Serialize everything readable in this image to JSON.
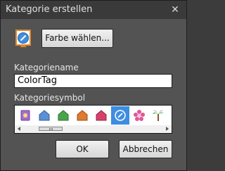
{
  "dialog": {
    "title": "Kategorie erstellen",
    "close_glyph": "✕"
  },
  "preview": {
    "icon": "tag-color-icon",
    "color": "#3f8fe0"
  },
  "color_button": {
    "label": "Farbe wählen..."
  },
  "name_field": {
    "label": "Kategoriename",
    "value": "ColorTag"
  },
  "symbols": {
    "label": "Kategoriesymbol",
    "items": [
      {
        "name": "flower-tag-icon",
        "color": "#a66bd3"
      },
      {
        "name": "house-blue-icon",
        "color": "#5c8fd6"
      },
      {
        "name": "house-green-icon",
        "color": "#4aa54a"
      },
      {
        "name": "house-orange-icon",
        "color": "#e07a2e"
      },
      {
        "name": "house-pink-icon",
        "color": "#d6416b"
      },
      {
        "name": "color-tag-icon",
        "color": "#3f8fe0",
        "selected": true
      },
      {
        "name": "pink-flower-icon",
        "color": "#e0579a"
      },
      {
        "name": "palm-tree-icon",
        "color": "#3c9a3c"
      }
    ]
  },
  "buttons": {
    "ok": "OK",
    "cancel": "Abbrechen"
  }
}
